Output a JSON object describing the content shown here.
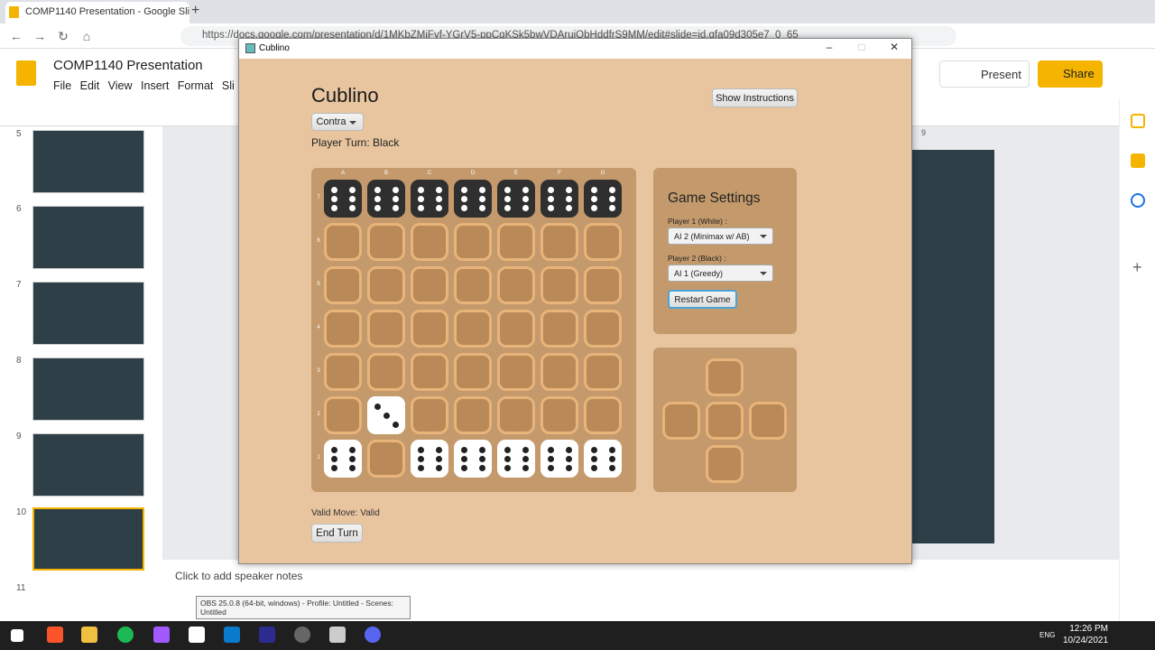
{
  "browser": {
    "tab_title": "COMP1140 Presentation - Google Sli",
    "new_tab": "+",
    "url": "https://docs.google.com/presentation/d/1MKbZMjFvf-YGrV5-ppCqKSk5bwVDAruiQbHddfrS9MM/edit#slide=id.gfa09d305e7_0_65"
  },
  "slides": {
    "title": "COMP1140 Presentation",
    "menu": [
      "File",
      "Edit",
      "View",
      "Insert",
      "Format",
      "Sli"
    ],
    "present_label": "Present",
    "share_label": "Share",
    "thumb_numbers": [
      "5",
      "6",
      "7",
      "8",
      "9",
      "10",
      "11"
    ],
    "notes_placeholder": "Click to add speaker notes",
    "ruler_mark": "9"
  },
  "tooltip": "OBS 25.0.8 (64-bit, windows) - Profile: Untitled - Scenes: Untitled",
  "taskbar": {
    "lang": "ENG",
    "time": "12:26 PM",
    "date": "10/24/2021"
  },
  "cublino": {
    "window_title": "Cublino",
    "title": "Cublino",
    "variant": "Contra",
    "show_instructions": "Show Instructions",
    "player_turn": "Player Turn:  Black",
    "board": {
      "cols": [
        "A",
        "B",
        "C",
        "D",
        "E",
        "F",
        "G"
      ],
      "rows": [
        "7",
        "6",
        "5",
        "4",
        "3",
        "2",
        "1"
      ],
      "black_dice_row": "7",
      "white_dice": [
        "A1",
        "C1",
        "D1",
        "E1",
        "F1",
        "G1",
        "B2"
      ]
    },
    "settings": {
      "heading": "Game Settings",
      "p1_label": "Player 1 (White) :",
      "p1_value": "AI 2 (Minimax w/ AB)",
      "p2_label": "Player 2 (Black) :",
      "p2_value": "AI 1 (Greedy)",
      "restart": "Restart Game"
    },
    "valid_move": "Valid Move: Valid",
    "end_turn": "End Turn"
  }
}
